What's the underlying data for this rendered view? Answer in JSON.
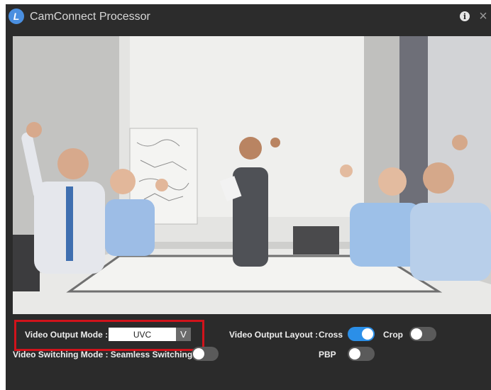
{
  "app": {
    "logo_letter": "L",
    "title": "CamConnect Processor",
    "info_glyph": "i",
    "close_glyph": "×"
  },
  "video": {
    "description_icon": "video-preview"
  },
  "controls": {
    "output_mode_label": "Video Output Mode :",
    "output_mode_value": "UVC",
    "dropdown_glyph": "V",
    "switching_mode_label": "Video Switching Mode : Seamless Switching",
    "switching_toggle_on": false,
    "layout_label": "Video Output Layout :",
    "layouts": [
      {
        "label": "Cross",
        "on": true
      },
      {
        "label": "Crop",
        "on": false
      },
      {
        "label": "PBP",
        "on": false
      }
    ]
  },
  "colors": {
    "accent": "#2b8fe8",
    "highlight": "#d1131b",
    "background": "#2b2b2b"
  }
}
